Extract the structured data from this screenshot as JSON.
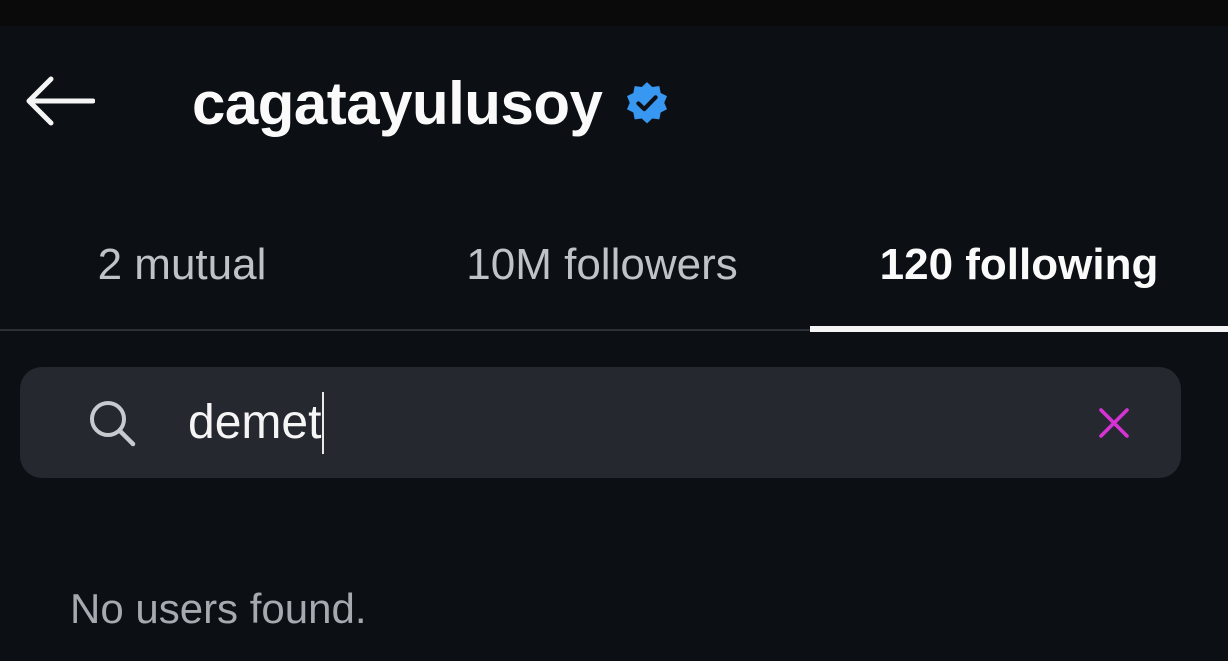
{
  "header": {
    "back_icon": "arrow-left-icon",
    "username": "cagatayulusoy",
    "verified_icon": "verified-badge-icon"
  },
  "tabs": [
    {
      "label": "2 mutual",
      "active": false
    },
    {
      "label": "10M followers",
      "active": false
    },
    {
      "label": "120 following",
      "active": true
    }
  ],
  "search": {
    "icon": "search-icon",
    "value": "demet",
    "clear_icon": "close-icon"
  },
  "results": {
    "empty_message": "No users found."
  },
  "colors": {
    "background": "#0c0f14",
    "search_field": "#25282e",
    "verified": "#3897f0",
    "clear_icon": "#d632d6"
  }
}
